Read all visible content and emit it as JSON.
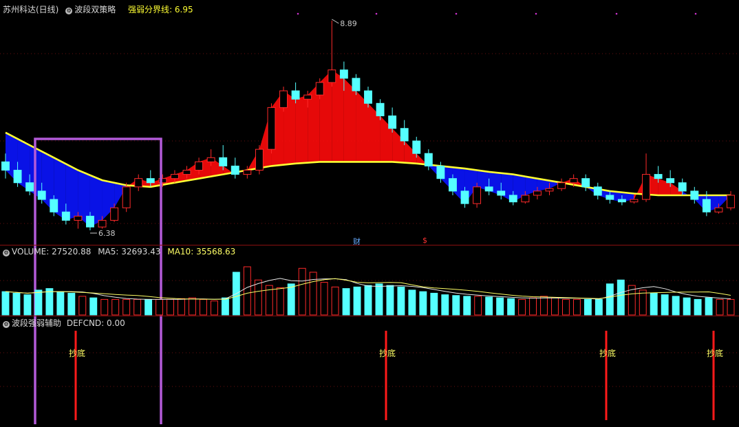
{
  "window": {
    "stock_title": "苏州科达(日线)",
    "strategy_name": "波段双策略",
    "threshold_label": "强弱分界线",
    "threshold_value": "6.95"
  },
  "volume_panel": {
    "label": "VOLUME",
    "value": "27520.88",
    "ma5_label": "MA5",
    "ma5_value": "32693.43",
    "ma10_label": "MA10",
    "ma10_value": "35568.63"
  },
  "indicator_panel": {
    "name": "波段强弱辅助",
    "defcnd_label": "DEFCND",
    "defcnd_value": "0.00"
  },
  "markers": {
    "finance_label": "财",
    "money_label": "$"
  },
  "colors": {
    "up": "#ff2a2a",
    "down": "#55ffff",
    "ma_yellow": "#ffff33",
    "band_blue": "#0a14ff",
    "band_red": "#ff0a0a",
    "highlight_box": "#b35ad8",
    "signal": "#ff1a1a",
    "signal_text": "#ffff66",
    "top_dots": "#cc33cc"
  },
  "chart_data": [
    {
      "type": "candlestick",
      "price_annotations": [
        {
          "label": "8.89",
          "value": 8.89
        },
        {
          "label": "6.38",
          "value": 6.38
        }
      ],
      "threshold_line": {
        "name": "强弱分界线",
        "value": 6.95
      },
      "candles": [
        [
          7.2,
          7.3,
          7.1,
          7.0
        ],
        [
          7.1,
          7.2,
          6.95,
          6.9
        ],
        [
          6.95,
          7.05,
          6.85,
          6.8
        ],
        [
          6.85,
          6.95,
          6.75,
          6.7
        ],
        [
          6.75,
          6.8,
          6.6,
          6.55
        ],
        [
          6.6,
          6.7,
          6.5,
          6.45
        ],
        [
          6.5,
          6.6,
          6.55,
          6.4
        ],
        [
          6.55,
          6.6,
          6.42,
          6.38
        ],
        [
          6.42,
          6.55,
          6.5,
          6.4
        ],
        [
          6.5,
          6.7,
          6.65,
          6.48
        ],
        [
          6.65,
          6.95,
          6.9,
          6.6
        ],
        [
          6.9,
          7.05,
          7.0,
          6.85
        ],
        [
          7.0,
          7.1,
          6.95,
          6.9
        ],
        [
          6.95,
          7.05,
          7.0,
          6.9
        ],
        [
          7.0,
          7.1,
          7.05,
          6.95
        ],
        [
          7.05,
          7.15,
          7.1,
          7.0
        ],
        [
          7.1,
          7.25,
          7.2,
          7.05
        ],
        [
          7.2,
          7.35,
          7.25,
          7.15
        ],
        [
          7.25,
          7.4,
          7.15,
          7.1
        ],
        [
          7.15,
          7.25,
          7.05,
          7.0
        ],
        [
          7.05,
          7.15,
          7.1,
          7.0
        ],
        [
          7.1,
          7.4,
          7.35,
          7.05
        ],
        [
          7.35,
          7.9,
          7.85,
          7.3
        ],
        [
          7.85,
          8.1,
          8.05,
          7.8
        ],
        [
          8.05,
          8.15,
          7.95,
          7.9
        ],
        [
          7.95,
          8.05,
          8.0,
          7.85
        ],
        [
          8.0,
          8.2,
          8.15,
          7.95
        ],
        [
          8.15,
          8.89,
          8.3,
          8.1
        ],
        [
          8.3,
          8.4,
          8.2,
          8.05
        ],
        [
          8.2,
          8.25,
          8.05,
          8.0
        ],
        [
          8.05,
          8.1,
          7.9,
          7.85
        ],
        [
          7.9,
          7.95,
          7.75,
          7.7
        ],
        [
          7.75,
          7.85,
          7.6,
          7.55
        ],
        [
          7.6,
          7.7,
          7.45,
          7.4
        ],
        [
          7.45,
          7.5,
          7.3,
          7.25
        ],
        [
          7.3,
          7.35,
          7.15,
          7.1
        ],
        [
          7.15,
          7.2,
          7.0,
          6.95
        ],
        [
          7.0,
          7.05,
          6.85,
          6.8
        ],
        [
          6.85,
          6.9,
          6.7,
          6.65
        ],
        [
          6.7,
          6.95,
          6.9,
          6.65
        ],
        [
          6.9,
          7.0,
          6.85,
          6.8
        ],
        [
          6.85,
          6.95,
          6.8,
          6.75
        ],
        [
          6.8,
          6.85,
          6.72,
          6.68
        ],
        [
          6.72,
          6.85,
          6.8,
          6.7
        ],
        [
          6.8,
          6.9,
          6.85,
          6.75
        ],
        [
          6.85,
          6.95,
          6.88,
          6.8
        ],
        [
          6.88,
          7.0,
          6.95,
          6.85
        ],
        [
          6.95,
          7.05,
          7.0,
          6.9
        ],
        [
          7.0,
          7.05,
          6.9,
          6.85
        ],
        [
          6.9,
          6.95,
          6.8,
          6.75
        ],
        [
          6.8,
          6.85,
          6.75,
          6.7
        ],
        [
          6.75,
          6.8,
          6.72,
          6.68
        ],
        [
          6.72,
          6.8,
          6.75,
          6.7
        ],
        [
          6.75,
          7.3,
          7.05,
          6.72
        ],
        [
          7.05,
          7.15,
          7.0,
          6.95
        ],
        [
          7.0,
          7.1,
          6.95,
          6.9
        ],
        [
          6.95,
          7.0,
          6.85,
          6.8
        ],
        [
          6.85,
          6.9,
          6.75,
          6.7
        ],
        [
          6.75,
          6.85,
          6.6,
          6.55
        ],
        [
          6.6,
          6.7,
          6.65,
          6.58
        ],
        [
          6.65,
          6.85,
          6.8,
          6.62
        ]
      ],
      "ma_yellow": [
        7.55,
        7.4,
        7.25,
        7.1,
        6.98,
        6.92,
        6.9,
        6.95,
        7.0,
        7.05,
        7.1,
        7.15,
        7.18,
        7.2,
        7.2,
        7.2,
        7.2,
        7.18,
        7.15,
        7.12,
        7.08,
        7.05,
        7.0,
        6.95,
        6.9,
        6.85,
        6.82,
        6.8,
        6.8,
        6.8,
        6.8
      ]
    },
    {
      "type": "bar",
      "name": "VOLUME",
      "values": [
        30,
        28,
        26,
        32,
        34,
        30,
        28,
        24,
        22,
        20,
        20,
        20,
        20,
        20,
        20,
        20,
        21,
        22,
        20,
        18,
        22,
        55,
        62,
        45,
        38,
        35,
        40,
        60,
        55,
        42,
        36,
        34,
        36,
        38,
        40,
        38,
        36,
        32,
        30,
        28,
        26,
        25,
        24,
        24,
        23,
        22,
        21,
        20,
        22,
        24,
        22,
        20,
        20,
        20,
        20,
        40,
        45,
        38,
        32,
        28,
        26,
        24,
        22,
        20,
        22,
        20,
        20
      ]
    },
    {
      "type": "signal",
      "name": "抄底",
      "labels": [
        "抄底",
        "抄底",
        "抄底",
        "抄底"
      ]
    }
  ]
}
